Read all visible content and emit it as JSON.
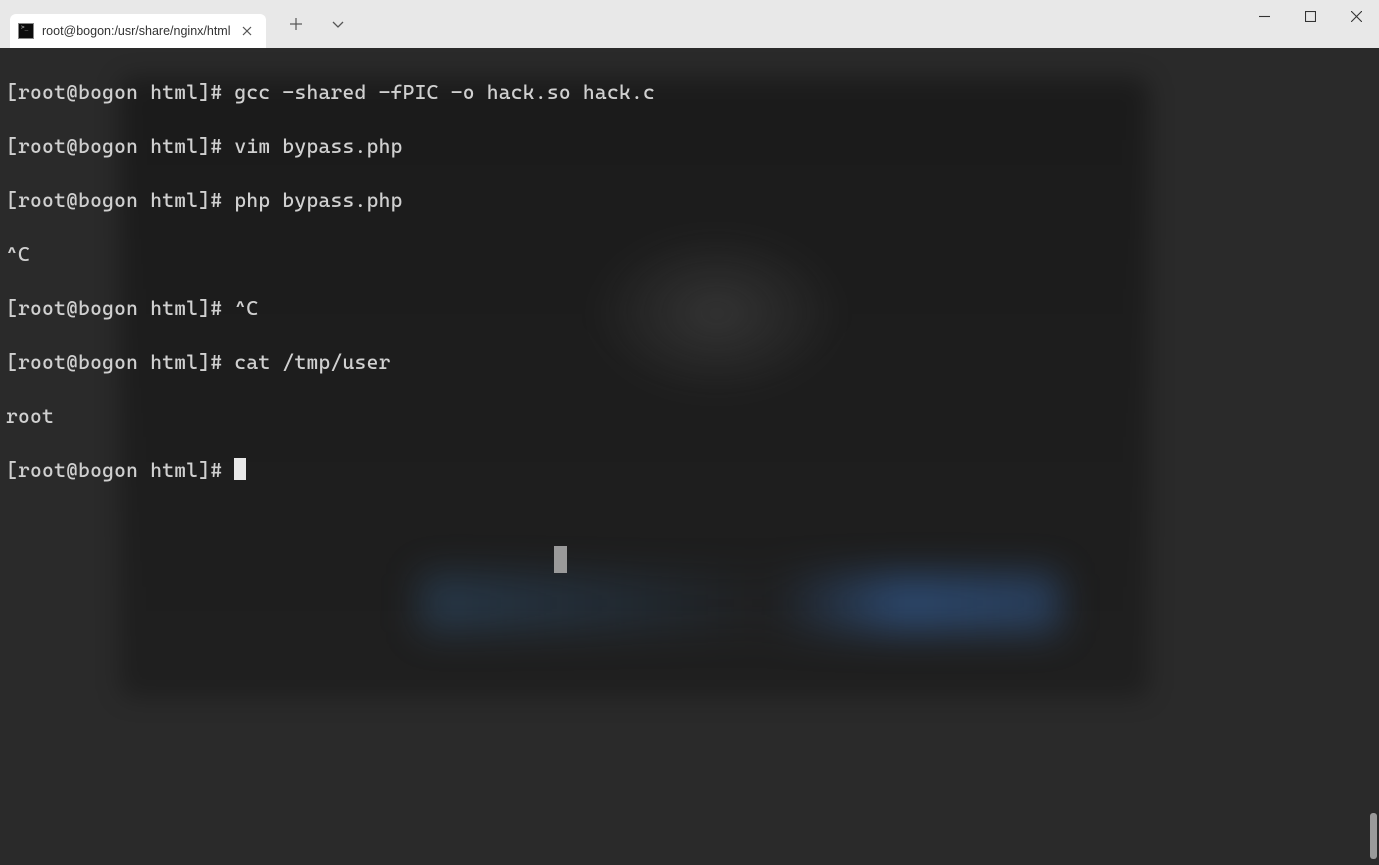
{
  "tab": {
    "title": "root@bogon:/usr/share/nginx/html",
    "icon_glyph": ">_"
  },
  "terminal": {
    "lines": [
      {
        "prompt": "[root@bogon html]# ",
        "cmd": "gcc -shared -fPIC -o hack.so hack.c"
      },
      {
        "prompt": "[root@bogon html]# ",
        "cmd": "vim bypass.php"
      },
      {
        "prompt": "[root@bogon html]# ",
        "cmd": "php bypass.php"
      },
      {
        "prompt": "",
        "cmd": "^C"
      },
      {
        "prompt": "[root@bogon html]# ",
        "cmd": "^C"
      },
      {
        "prompt": "[root@bogon html]# ",
        "cmd": "cat /tmp/user"
      },
      {
        "prompt": "",
        "cmd": "root"
      }
    ],
    "current_prompt": "[root@bogon html]# "
  }
}
